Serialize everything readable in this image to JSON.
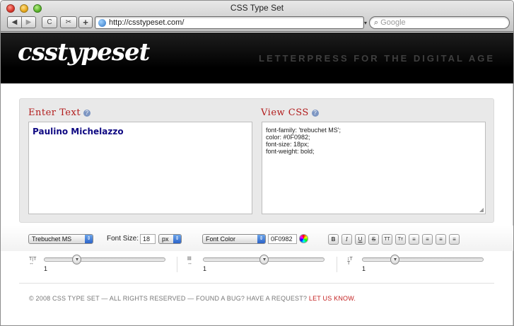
{
  "window": {
    "title": "CSS Type Set"
  },
  "toolbar": {
    "back_glyph": "◀",
    "forward_glyph": "▶",
    "reload_glyph": "C",
    "bookmark_glyph": "✂",
    "newtab_glyph": "+",
    "url": "http://csstypeset.com/",
    "search_placeholder": "Google"
  },
  "header": {
    "logo": "csstypeset",
    "tagline": "LETTERPRESS FOR THE DIGITAL AGE"
  },
  "enter_panel": {
    "heading": "Enter Text",
    "text": "Paulino Michelazzo"
  },
  "view_panel": {
    "heading": "View CSS",
    "css_lines": [
      "font-family: 'trebuchet MS';",
      "color: #0F0982;",
      "font-size: 18px;",
      "font-weight: bold;"
    ]
  },
  "controls": {
    "font_family": "Trebuchet MS",
    "font_size_label": "Font Size:",
    "font_size_value": "18",
    "unit": "px",
    "color_label": "Font Color",
    "hex_value": "0F0982",
    "format_buttons": [
      "B",
      "I",
      "U",
      "S",
      "TT",
      "Tт",
      "≡",
      "≡",
      "≡",
      "≡"
    ]
  },
  "sliders": [
    {
      "name": "letter-spacing",
      "value": "1",
      "level": 0.25
    },
    {
      "name": "word-spacing",
      "value": "1",
      "level": 0.5
    },
    {
      "name": "line-height",
      "value": "1",
      "level": 0.25
    }
  ],
  "footer": {
    "text": "© 2008 CSS TYPE SET — ALL RIGHTS RESERVED — FOUND A BUG? HAVE A REQUEST?",
    "link": "LET US KNOW."
  },
  "colors": {
    "accent_red": "#b21b1b",
    "text_navy": "#0F0982",
    "header_bg": "#000000"
  }
}
